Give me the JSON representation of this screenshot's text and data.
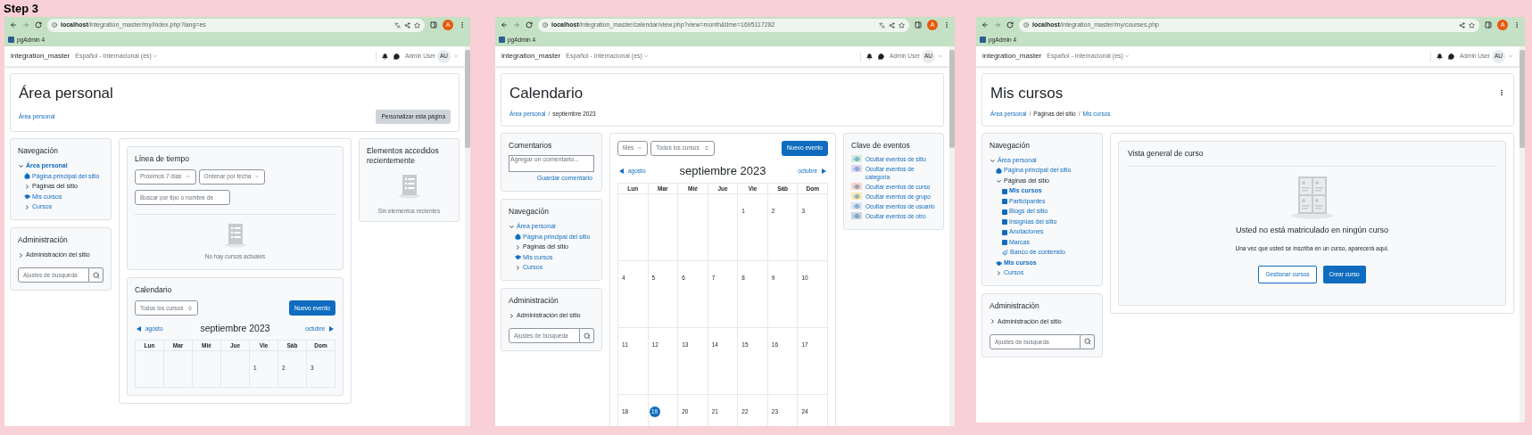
{
  "step_label": "Step 3",
  "windows": [
    {
      "url_host": "localhost",
      "url_path": "/integration_master/my/index.php?lang=es",
      "translate_button": true,
      "profile_letter": "A",
      "bookmark": "pgAdmin 4",
      "site_name": "integration_master",
      "language": "Español - Internacional (es)",
      "user_name": "Admin User",
      "user_initials": "AU",
      "page_title": "Área personal",
      "breadcrumbs": [
        {
          "text": "Área personal",
          "link": true
        }
      ],
      "header_buttons": [
        {
          "label": "Personalizar esta página",
          "kind": "secondary"
        }
      ],
      "left_column": [
        {
          "kind": "navigation",
          "title": "Navegación",
          "items": [
            {
              "text": "Área personal",
              "kind": "expandable",
              "expanded": true,
              "link": true,
              "current": true,
              "children": [
                {
                  "text": "Página principal del sitio",
                  "kind": "home",
                  "link": true,
                  "current": false
                },
                {
                  "text": "Páginas del sitio",
                  "kind": "expandable",
                  "expanded": false,
                  "link": false,
                  "current": false
                },
                {
                  "text": "Mis cursos",
                  "kind": "courses",
                  "link": true,
                  "current": false
                },
                {
                  "text": "Cursos",
                  "kind": "expandable",
                  "expanded": false,
                  "link": true,
                  "current": false
                }
              ]
            }
          ]
        },
        {
          "kind": "administration",
          "title": "Administración",
          "items": [
            {
              "text": "Administración del sitio",
              "kind": "expandable",
              "expanded": false,
              "link": false,
              "current": false
            }
          ],
          "search_placeholder": "Ajustes de busqueda"
        }
      ],
      "main_column": [
        {
          "kind": "timeline",
          "title": "Línea de tiempo",
          "filters": [
            "Próximos 7 días",
            "Ordenar por fecha"
          ],
          "search_placeholder": "Buscar por tipo o nombre de",
          "empty_text": "No hay cursos actuales"
        },
        {
          "kind": "calendar",
          "title": "Calendario",
          "course_select": "Todos los cursos",
          "new_button": "Nuevo evento",
          "prev": "agosto",
          "month": "septiembre 2023",
          "next": "octubre",
          "weekdays": [
            "Lun",
            "Mar",
            "Mié",
            "Jue",
            "Vie",
            "Sáb",
            "Dom"
          ],
          "weeks": [
            [
              {
                "kind": "blank"
              },
              {
                "kind": "blank"
              },
              {
                "kind": "blank"
              },
              {
                "kind": "blank"
              },
              {
                "kind": "day",
                "text": "1",
                "today": false
              },
              {
                "kind": "day",
                "text": "2",
                "today": false
              },
              {
                "kind": "day",
                "text": "3",
                "today": false
              }
            ]
          ]
        }
      ],
      "right_column": [
        {
          "kind": "recent_items",
          "title": "Elementos accedidos recientemente",
          "empty_text": "Sin elementos recientes"
        }
      ]
    },
    {
      "url_host": "localhost",
      "url_path": "/integration_master/calendar/view.php?view=month&time=1695117282",
      "translate_button": true,
      "profile_letter": "A",
      "bookmark": "pgAdmin 4",
      "site_name": "integration_master",
      "language": "Español - Internacional (es)",
      "user_name": "Admin User",
      "user_initials": "AU",
      "page_title": "Calendario",
      "breadcrumbs": [
        {
          "text": "Área personal",
          "link": true
        },
        {
          "text": "septiembre 2023",
          "link": false
        }
      ],
      "breadcrumb_separator": "/",
      "left_column": [
        {
          "kind": "comments",
          "title": "Comentarios",
          "placeholder": "Agregar un comentario...",
          "save_link": "Guardar comentario"
        },
        {
          "kind": "navigation",
          "title": "Navegación",
          "items": [
            {
              "text": "Área personal",
              "kind": "expandable",
              "expanded": true,
              "link": true,
              "current": false,
              "children": [
                {
                  "text": "Página principal del sitio",
                  "kind": "home",
                  "link": true,
                  "current": false
                },
                {
                  "text": "Páginas del sitio",
                  "kind": "expandable",
                  "expanded": false,
                  "link": false,
                  "current": false
                },
                {
                  "text": "Mis cursos",
                  "kind": "courses",
                  "link": true,
                  "current": false
                },
                {
                  "text": "Cursos",
                  "kind": "expandable",
                  "expanded": false,
                  "link": true,
                  "current": false
                }
              ]
            }
          ]
        },
        {
          "kind": "administration",
          "title": "Administración",
          "items": [
            {
              "text": "Administración del sitio",
              "kind": "expandable",
              "expanded": false,
              "link": false,
              "current": false
            }
          ],
          "search_placeholder": "Ajustes de búsqueda"
        }
      ],
      "main_column": [
        {
          "kind": "calendar",
          "view_select": "Mes",
          "course_select": "Todos los cursos",
          "new_button": "Nuevo evento",
          "prev": "agosto",
          "month": "septiembre 2023",
          "next": "octubre",
          "weekdays": [
            "Lun",
            "Mar",
            "Mié",
            "Jue",
            "Vie",
            "Sáb",
            "Dom"
          ],
          "weeks": [
            [
              {
                "kind": "blank"
              },
              {
                "kind": "blank"
              },
              {
                "kind": "blank"
              },
              {
                "kind": "blank"
              },
              {
                "kind": "day",
                "text": "1",
                "today": false
              },
              {
                "kind": "day",
                "text": "2",
                "today": false
              },
              {
                "kind": "day",
                "text": "3",
                "today": false
              }
            ],
            [
              {
                "text": "4",
                "today": false
              },
              {
                "text": "5",
                "today": false
              },
              {
                "text": "6",
                "today": false
              },
              {
                "text": "7",
                "today": false
              },
              {
                "text": "8",
                "today": false
              },
              {
                "text": "9",
                "today": false
              },
              {
                "text": "10",
                "today": false
              }
            ],
            [
              {
                "text": "11",
                "today": false
              },
              {
                "text": "12",
                "today": false
              },
              {
                "text": "13",
                "today": false
              },
              {
                "text": "14",
                "today": false
              },
              {
                "text": "15",
                "today": false
              },
              {
                "text": "16",
                "today": false
              },
              {
                "text": "17",
                "today": false
              }
            ],
            [
              {
                "text": "18",
                "today": false
              },
              {
                "text": "19",
                "today": true
              },
              {
                "text": "20",
                "today": false
              },
              {
                "text": "21",
                "today": false
              },
              {
                "text": "22",
                "today": false
              },
              {
                "text": "23",
                "today": false
              },
              {
                "text": "24",
                "today": false
              }
            ]
          ]
        }
      ],
      "right_column": [
        {
          "kind": "event_key",
          "title": "Clave de eventos",
          "items": [
            {
              "text": "Ocultar eventos de sitio",
              "color": "#d4edda"
            },
            {
              "text": "Ocultar eventos de categoría",
              "color": "#e2d5ec"
            },
            {
              "text": "Ocultar eventos de curso",
              "color": "#fbd5c5"
            },
            {
              "text": "Ocultar eventos de grupo",
              "color": "#fde9b3"
            },
            {
              "text": "Ocultar eventos de usuario",
              "color": "#dbe5ef"
            },
            {
              "text": "Ocultar eventos de otro",
              "color": "#ced4da"
            }
          ]
        }
      ]
    },
    {
      "url_host": "localhost",
      "url_path": "/integration_master/my/courses.php",
      "profile_letter": "A",
      "bookmark": "pgAdmin 4",
      "site_name": "integration_master",
      "language": "Español - Internacional (es)",
      "user_name": "Admin User",
      "user_initials": "AU",
      "page_title": "Mis cursos",
      "header_menu": true,
      "breadcrumbs": [
        {
          "text": "Área personal",
          "link": true
        },
        {
          "text": "Páginas del sitio",
          "link": false
        },
        {
          "text": "Mis cursos",
          "link": true
        }
      ],
      "breadcrumb_separator": "/",
      "left_column": [
        {
          "kind": "navigation",
          "title": "Navegación",
          "items": [
            {
              "text": "Área personal",
              "kind": "expandable",
              "expanded": true,
              "link": true,
              "current": false,
              "children": [
                {
                  "text": "Página principal del sitio",
                  "kind": "home",
                  "link": true,
                  "current": false
                },
                {
                  "text": "Páginas del sitio",
                  "kind": "expandable",
                  "expanded": true,
                  "link": false,
                  "current": false,
                  "children": [
                    {
                      "text": "Mis cursos",
                      "kind": "page",
                      "link": true,
                      "current": true
                    },
                    {
                      "text": "Participantes",
                      "kind": "page",
                      "link": true,
                      "current": false
                    },
                    {
                      "text": "Blogs del sitio",
                      "kind": "page",
                      "link": true,
                      "current": false
                    },
                    {
                      "text": "Insignias del sitio",
                      "kind": "page",
                      "link": true,
                      "current": false
                    },
                    {
                      "text": "Anotaciones",
                      "kind": "page",
                      "link": true,
                      "current": false
                    },
                    {
                      "text": "Marcas",
                      "kind": "page",
                      "link": true,
                      "current": false
                    },
                    {
                      "text": "Banco de contenido",
                      "kind": "tool",
                      "link": true,
                      "current": false
                    }
                  ]
                },
                {
                  "text": "Mis cursos",
                  "kind": "courses",
                  "link": true,
                  "current": true
                },
                {
                  "text": "Cursos",
                  "kind": "expandable",
                  "expanded": false,
                  "link": true,
                  "current": false
                }
              ]
            }
          ]
        },
        {
          "kind": "administration",
          "title": "Administración",
          "items": [
            {
              "text": "Administración del sitio",
              "kind": "expandable",
              "expanded": false,
              "link": false,
              "current": false
            }
          ],
          "search_placeholder": "Ajustes de búsqueda"
        }
      ],
      "main_column": [
        {
          "kind": "course_overview",
          "title": "Vista general de curso",
          "heading": "Usted no está matriculado en ningún curso",
          "text": "Una vez que usted se inscriba en un curso, aparecerá aquí.",
          "buttons": [
            {
              "label": "Gestionar cursos",
              "kind": "outline"
            },
            {
              "label": "Crear curso",
              "kind": "primary"
            }
          ]
        }
      ]
    }
  ]
}
